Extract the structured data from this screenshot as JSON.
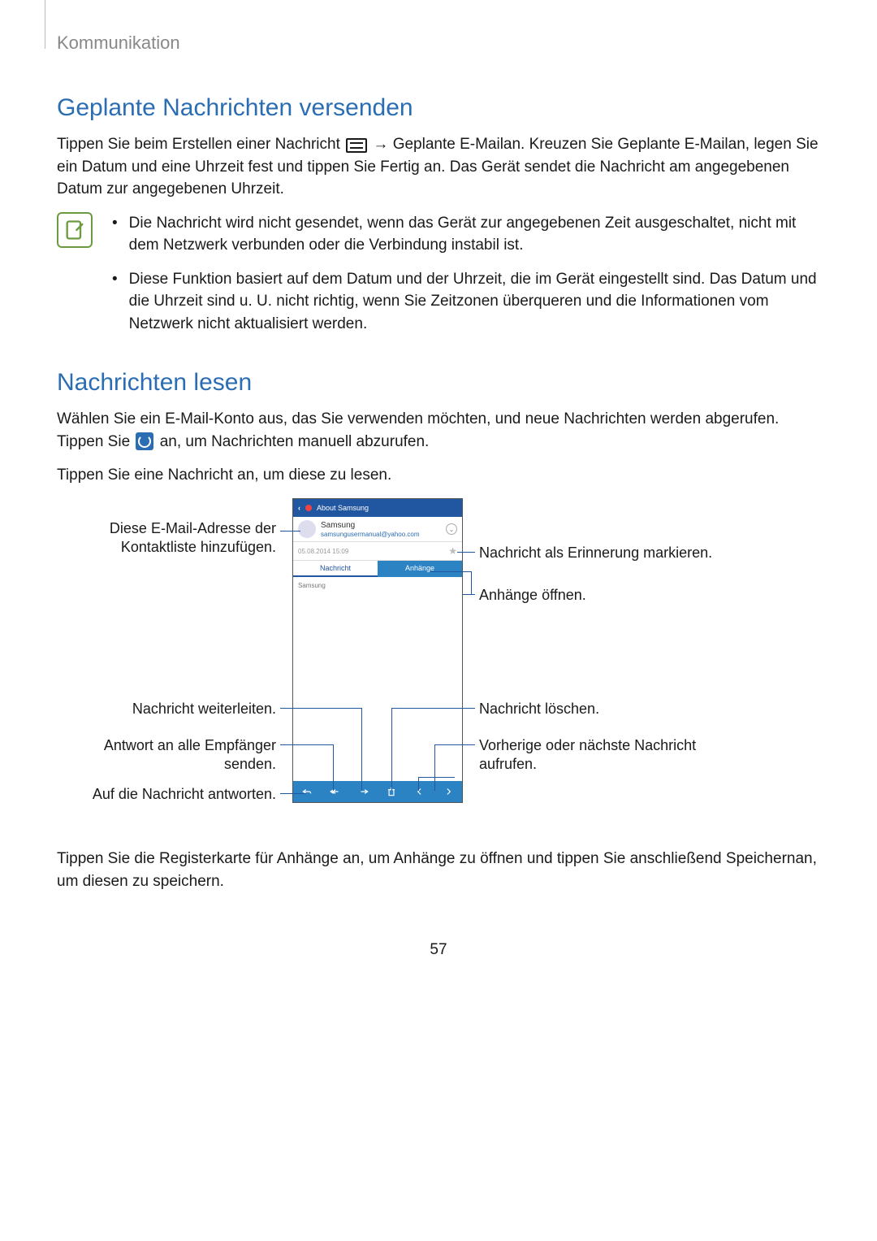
{
  "breadcrumb": "Kommunikation",
  "section1": {
    "heading": "Geplante Nachrichten versenden",
    "p1_a": "Tippen Sie beim Erstellen einer Nachricht ",
    "p1_b": " → Geplante E-Mailan. Kreuzen Sie Geplante E-Mailan, legen Sie ein Datum und eine Uhrzeit fest und tippen Sie Fertig an. Das Gerät sendet die Nachricht am angegebenen Datum zur angegebenen Uhrzeit.",
    "bullets": [
      "Die Nachricht wird nicht gesendet, wenn das Gerät zur angegebenen Zeit ausgeschaltet, nicht mit dem Netzwerk verbunden oder die Verbindung instabil ist.",
      "Diese Funktion basiert auf dem Datum und der Uhrzeit, die im Gerät eingestellt sind. Das Datum und die Uhrzeit sind u. U. nicht richtig, wenn Sie Zeitzonen überqueren und die Informationen vom Netzwerk nicht aktualisiert werden."
    ]
  },
  "section2": {
    "heading": "Nachrichten lesen",
    "p1": "Wählen Sie ein E-Mail-Konto aus, das Sie verwenden möchten, und neue Nachrichten werden abgerufen. Tippen Sie ",
    "p1b": " an, um Nachrichten manuell abzurufen.",
    "p2": "Tippen Sie eine Nachricht an, um diese zu lesen.",
    "p3": "Tippen Sie die Registerkarte für Anhänge an, um Anhänge zu öffnen und tippen Sie anschließend Speichernan, um diesen zu speichern."
  },
  "phone": {
    "title": "About Samsung",
    "sender_name": "Samsung",
    "sender_email": "samsungusermanual@yahoo.com",
    "date": "05.08.2014  15:09",
    "tab_message": "Nachricht",
    "tab_attachments": "Anhänge",
    "body_text": "Samsung"
  },
  "callouts": {
    "left_contact": "Diese E-Mail-Adresse der Kontaktliste hinzufügen.",
    "left_forward": "Nachricht weiterleiten.",
    "left_replyall": "Antwort an alle Empfänger senden.",
    "left_reply": "Auf die Nachricht antworten.",
    "right_star": "Nachricht als Erinnerung markieren.",
    "right_attach": "Anhänge öffnen.",
    "right_delete": "Nachricht löschen.",
    "right_nav": "Vorherige oder nächste Nachricht aufrufen."
  },
  "page_number": "57"
}
